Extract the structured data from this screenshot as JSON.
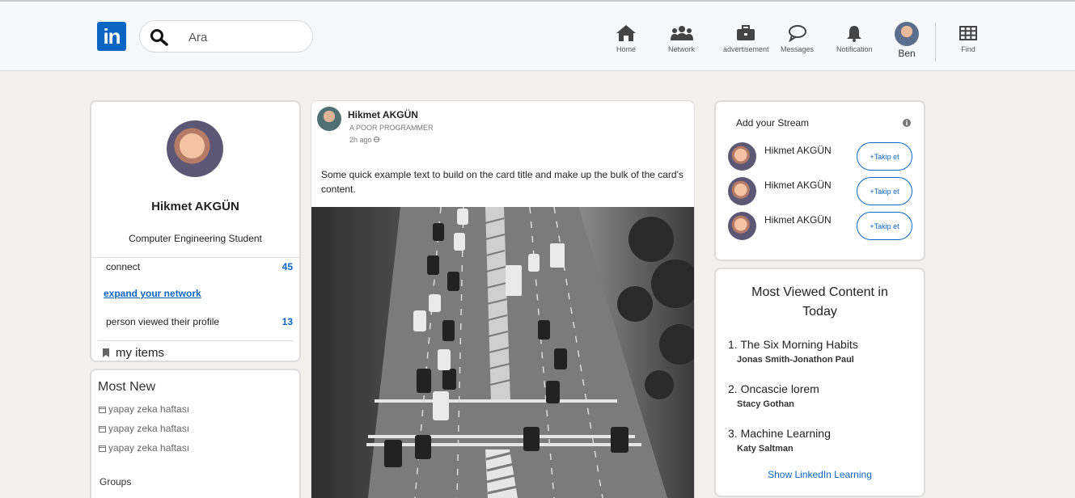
{
  "header": {
    "search_placeholder": "Ara",
    "nav": {
      "home": "Home",
      "network": "Network",
      "advertisement": "advertisement",
      "messages": "Messages",
      "notification": "Notification",
      "me": "Ben",
      "find": "Find"
    }
  },
  "profile": {
    "name": "Hikmet AKGÜN",
    "title": "Computer Engineering Student",
    "connect_label": "connect",
    "connect_count": "45",
    "expand_link": "expand your network",
    "viewed_label": "person viewed their profile",
    "viewed_count": "13",
    "my_items": "my items"
  },
  "most_new": {
    "title": "Most New",
    "items": [
      "yapay zeka haftası",
      "yapay zeka haftası",
      "yapay zeka haftası"
    ],
    "groups": "Groups"
  },
  "post": {
    "author": "Hikmet AKGÜN",
    "subtitle": "A POOR PROGRAMMER",
    "time": "2h ago",
    "text": "Some quick example text to build on the card title and make up the bulk of the card's content."
  },
  "stream": {
    "title": "Add your Stream",
    "rows": [
      {
        "name": "Hikmet AKGÜN",
        "button": "+Takip et"
      },
      {
        "name": "Hikmet AKGÜN",
        "button": "+Takip et"
      },
      {
        "name": "Hikmet AKGÜN",
        "button": "+Takip et"
      }
    ]
  },
  "most_viewed": {
    "title": "Most Viewed Content in Today",
    "items": [
      {
        "title": "1. The Six Morning Habits",
        "author": "Jonas Smith-Jonathon Paul"
      },
      {
        "title": "2. Oncascie lorem",
        "author": "Stacy Gothan"
      },
      {
        "title": "3. Machine Learning",
        "author": "Katy Saltman"
      }
    ],
    "link": "Show LinkedIn Learning"
  },
  "colors": {
    "brand": "#0a66c2",
    "background": "#f2f1ee"
  }
}
